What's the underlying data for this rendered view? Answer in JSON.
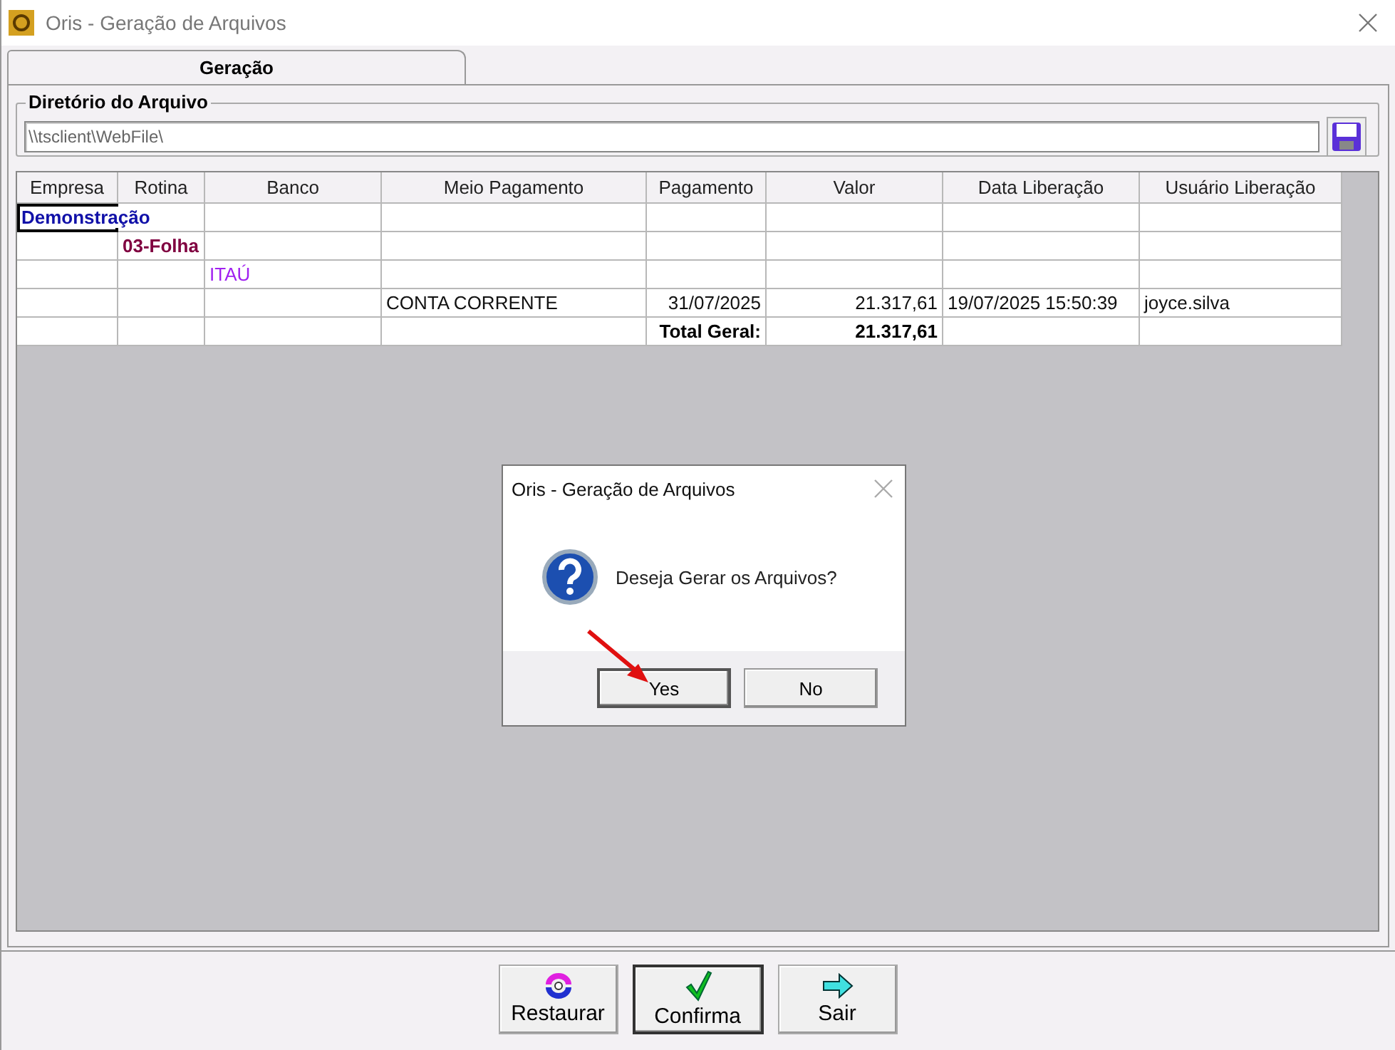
{
  "window": {
    "title": "Oris - Geração de Arquivos"
  },
  "tabs": [
    {
      "label": "Geração",
      "selected": true
    }
  ],
  "directory": {
    "label": "Diretório do Arquivo",
    "value": "\\\\tsclient\\WebFile\\"
  },
  "table": {
    "columns": [
      "Empresa",
      "Rotina",
      "Banco",
      "Meio Pagamento",
      "Pagamento",
      "Valor",
      "Data Liberação",
      "Usuário Liberação"
    ],
    "rows": [
      {
        "kind": "empresa",
        "focused": true,
        "cells": [
          "Demonstração",
          null,
          null,
          null,
          null,
          null,
          null,
          null
        ]
      },
      {
        "kind": "rotina",
        "focused": false,
        "cells": [
          null,
          "03-Folha",
          null,
          null,
          null,
          null,
          null,
          null
        ]
      },
      {
        "kind": "banco",
        "focused": false,
        "cells": [
          null,
          null,
          "ITAÚ",
          null,
          null,
          null,
          null,
          null
        ]
      },
      {
        "kind": "detail",
        "focused": false,
        "cells": [
          null,
          null,
          null,
          "CONTA CORRENTE",
          "31/07/2025",
          "21.317,61",
          "19/07/2025 15:50:39",
          "joyce.silva"
        ]
      },
      {
        "kind": "total",
        "focused": false,
        "cells": [
          null,
          null,
          null,
          null,
          "Total Geral:",
          "21.317,61",
          null,
          null
        ]
      }
    ]
  },
  "dialog": {
    "title": "Oris - Geração de Arquivos",
    "message": "Deseja Gerar os Arquivos?",
    "buttons": [
      {
        "label": "Yes",
        "default": true
      },
      {
        "label": "No",
        "default": false
      }
    ]
  },
  "buttons": [
    {
      "label": "Restaurar",
      "kind": "restore",
      "default": false
    },
    {
      "label": "Confirma",
      "kind": "confirm",
      "default": true
    },
    {
      "label": "Sair",
      "kind": "exit",
      "default": false
    }
  ]
}
